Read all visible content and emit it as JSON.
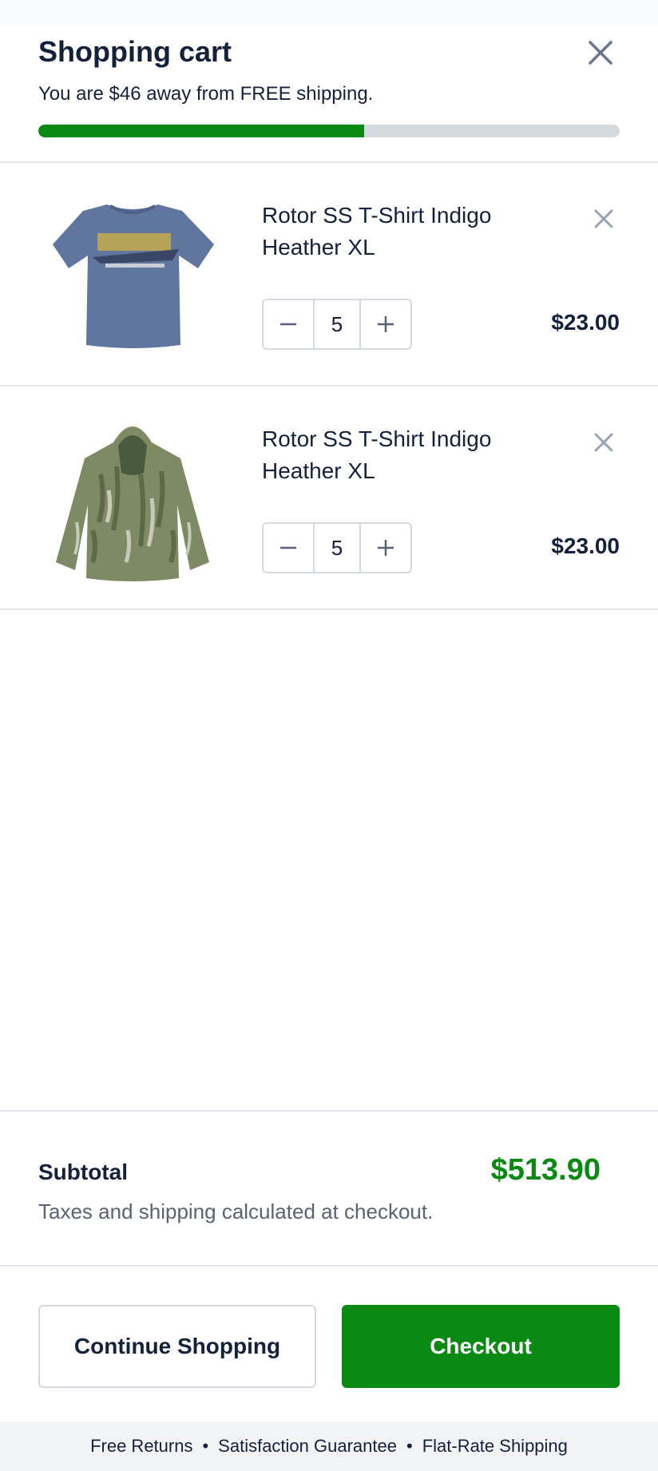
{
  "header": {
    "title": "Shopping cart",
    "shipping_message": "You are $46 away from FREE shipping.",
    "shipping_progress_percent": 56
  },
  "items": [
    {
      "name": "Rotor SS T-Shirt Indigo Heather XL",
      "quantity": "5",
      "price": "$23.00",
      "image_icon": "tshirt-image"
    },
    {
      "name": "Rotor SS T-Shirt Indigo Heather XL",
      "quantity": "5",
      "price": "$23.00",
      "image_icon": "camo-hoodie-image"
    }
  ],
  "summary": {
    "subtotal_label": "Subtotal",
    "subtotal_value": "$513.90",
    "tax_note": "Taxes and shipping calculated at checkout."
  },
  "actions": {
    "continue_label": "Continue Shopping",
    "checkout_label": "Checkout"
  },
  "footer": {
    "perks": [
      "Free Returns",
      "Satisfaction Guarantee",
      "Flat-Rate Shipping"
    ],
    "separator": "•"
  },
  "colors": {
    "accent_green": "#0a8a12",
    "text_dark": "#14213d",
    "progress_track": "#d5dae0"
  }
}
